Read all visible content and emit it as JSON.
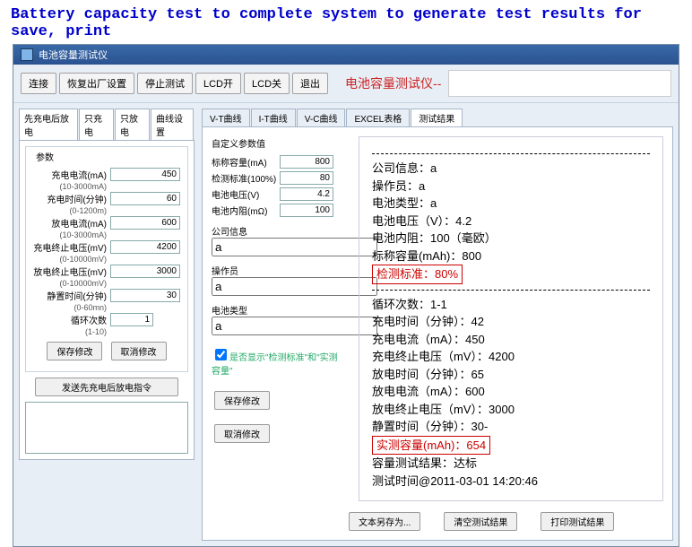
{
  "caption": "Battery capacity test to complete system to generate test results for save, print",
  "title": "电池容量测试仪",
  "toolbar": {
    "b1": "连接",
    "b2": "恢复出厂设置",
    "b3": "停止测试",
    "b4": "LCD开",
    "b5": "LCD关",
    "b6": "退出"
  },
  "devtitle": "电池容量测试仪--",
  "lefttabs": {
    "t1": "先充电后放电",
    "t2": "只充电",
    "t3": "只放电",
    "t4": "曲线设置"
  },
  "params_title": "参数",
  "p": {
    "l1": "充电电流(mA)",
    "v1": "450",
    "h1": "(10-3000mA)",
    "l2": "充电时间(分钟)",
    "v2": "60",
    "h2": "(0-1200m)",
    "l3": "放电电流(mA)",
    "v3": "600",
    "h3": "(10-3000mA)",
    "l4": "充电终止电压(mV)",
    "v4": "4200",
    "h4": "(0-10000mV)",
    "l5": "放电终止电压(mV)",
    "v5": "3000",
    "h5": "(0-10000mV)",
    "l6": "静置时间(分钟)",
    "v6": "30",
    "h6": "(0-60mn)",
    "l7": "循环次数",
    "v7": "1",
    "h7": "(1-10)"
  },
  "btns": {
    "save": "保存修改",
    "cancel": "取消修改",
    "send": "发送先充电后放电指令"
  },
  "rtabs": {
    "t1": "V-T曲线",
    "t2": "I-T曲线",
    "t3": "V-C曲线",
    "t4": "EXCEL表格",
    "t5": "测试结果"
  },
  "custom_title": "自定义参数值",
  "c": {
    "l1": "标称容量(mA)",
    "v1": "800",
    "l2": "检测标准(100%)",
    "v2": "80",
    "l3": "电池电压(V)",
    "v3": "4.2",
    "l4": "电池内阻(mΩ)",
    "v4": "100",
    "l5": "公司信息",
    "v5": "a",
    "l6": "操作员",
    "v6": "a",
    "l7": "电池类型",
    "v7": "a"
  },
  "chk": "是否显示\"检测标准\"和\"实测容量\"",
  "rbtns": {
    "save": "保存修改",
    "cancel": "取消修改"
  },
  "report": {
    "r1": "公司信息：a",
    "r2": "操作员：a",
    "r3": "电池类型：a",
    "r4": "电池电压（V）：4.2",
    "r5": "电池内阻：100（毫欧）",
    "r6": "标称容量(mAh)：800",
    "r7": "检测标准：80%",
    "r8": "循环次数：1-1",
    "r9": "充电时间（分钟）：42",
    "r10": "充电电流（mA）：450",
    "r11": "充电终止电压（mV）：4200",
    "r12": "放电时间（分钟）：65",
    "r13": "放电电流（mA）：600",
    "r14": "放电终止电压（mV）：3000",
    "r15": "静置时间（分钟）：30-",
    "r16": "实测容量(mAh)：654",
    "r17": "容量测试结果：达标",
    "r18": "测试时间@2011-03-01 14:20:46"
  },
  "bbtns": {
    "b1": "文本另存为...",
    "b2": "清空测试结果",
    "b3": "打印测试结果"
  }
}
